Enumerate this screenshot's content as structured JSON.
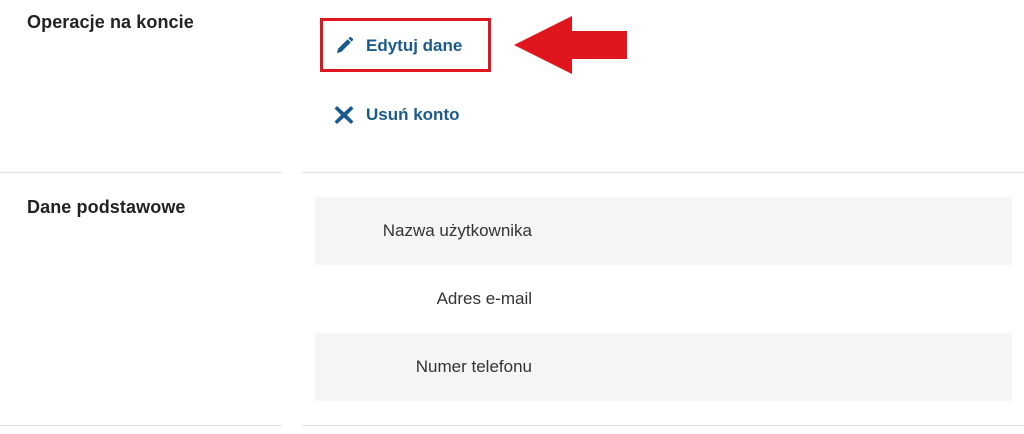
{
  "account_operations": {
    "title": "Operacje na koncie",
    "edit_label": "Edytuj dane",
    "delete_label": "Usuń konto"
  },
  "basic_data": {
    "title": "Dane podstawowe",
    "fields": [
      {
        "label": "Nazwa użytkownika"
      },
      {
        "label": "Adres e-mail"
      },
      {
        "label": "Numer telefonu"
      }
    ]
  },
  "colors": {
    "link": "#1a5b8d",
    "highlight": "#e0161e",
    "row_shade": "#f5f5f7"
  },
  "icons": {
    "edit": "pencil-icon",
    "delete": "cross-icon",
    "annotation": "left-arrow-icon"
  }
}
